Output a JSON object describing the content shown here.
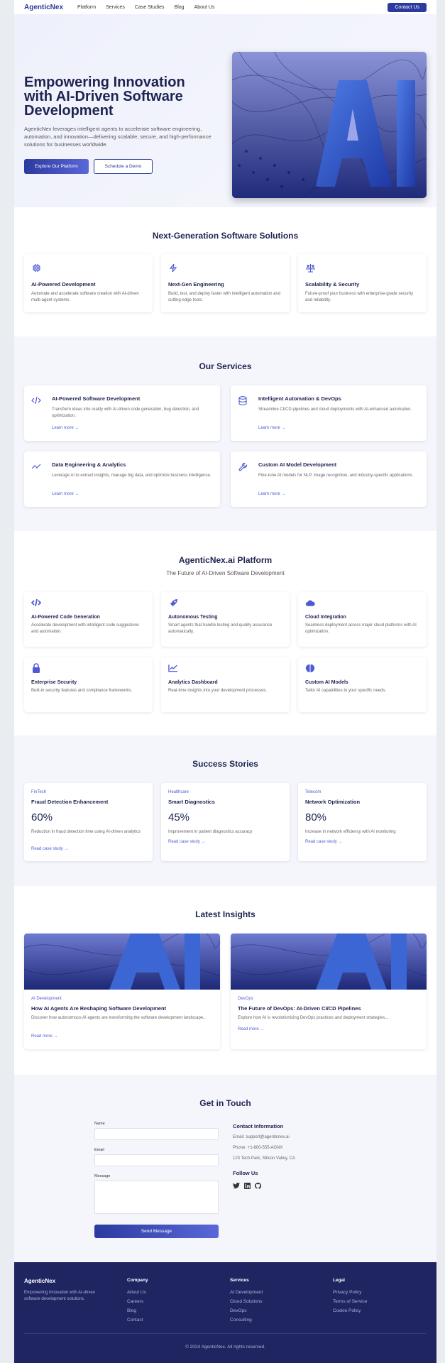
{
  "nav": {
    "logo": "AgenticNex",
    "links": [
      "Platform",
      "Services",
      "Case Studies",
      "Blog",
      "About Us"
    ],
    "cta": "Contact Us"
  },
  "hero": {
    "title": "Empowering Innovation with AI-Driven Software Development",
    "description": "AgenticNex leverages intelligent agents to accelerate software engineering, automation, and innovation—delivering scalable, secure, and high-performance solutions for businesses worldwide.",
    "primary_btn": "Explore Our Platform",
    "secondary_btn": "Schedule a Demo",
    "image_text": "AI"
  },
  "solutions": {
    "heading": "Next-Generation Software Solutions",
    "items": [
      {
        "icon": "chip-icon",
        "title": "AI-Powered Development",
        "desc": "Automate and accelerate software creation with AI-driven multi-agent systems."
      },
      {
        "icon": "bolt-icon",
        "title": "Next-Gen Engineering",
        "desc": "Build, test, and deploy faster with intelligent automation and cutting-edge tools."
      },
      {
        "icon": "scale-icon",
        "title": "Scalability & Security",
        "desc": "Future-proof your business with enterprise-grade security and reliability."
      }
    ]
  },
  "services": {
    "heading": "Our Services",
    "items": [
      {
        "icon": "code-icon",
        "title": "AI-Powered Software Development",
        "desc": "Transform ideas into reality with AI-driven code generation, bug detection, and optimization.",
        "link": "Learn more →"
      },
      {
        "icon": "database-icon",
        "title": "Intelligent Automation & DevOps",
        "desc": "Streamline CI/CD pipelines and cloud deployments with AI-enhanced automation.",
        "link": "Learn more →"
      },
      {
        "icon": "chart-line-icon",
        "title": "Data Engineering & Analytics",
        "desc": "Leverage AI to extract insights, manage big data, and optimize business intelligence.",
        "link": "Learn more →"
      },
      {
        "icon": "wrench-icon",
        "title": "Custom AI Model Development",
        "desc": "Fine-tune AI models for NLP, image recognition, and industry-specific applications.",
        "link": "Learn more →"
      }
    ]
  },
  "platform": {
    "heading": "AgenticNex.ai Platform",
    "subheading": "The Future of AI-Driven Software Development",
    "items": [
      {
        "icon": "code-icon",
        "title": "AI-Powered Code Generation",
        "desc": "Accelerate development with intelligent code suggestions and automation."
      },
      {
        "icon": "rocket-icon",
        "title": "Autonomous Testing",
        "desc": "Smart agents that handle testing and quality assurance automatically."
      },
      {
        "icon": "cloud-icon",
        "title": "Cloud Integration",
        "desc": "Seamless deployment across major cloud platforms with AI optimization."
      },
      {
        "icon": "lock-icon",
        "title": "Enterprise Security",
        "desc": "Built-in security features and compliance frameworks."
      },
      {
        "icon": "analytics-icon",
        "title": "Analytics Dashboard",
        "desc": "Real-time insights into your development processes."
      },
      {
        "icon": "brain-icon",
        "title": "Custom AI Models",
        "desc": "Tailor AI capabilities to your specific needs."
      }
    ]
  },
  "stories": {
    "heading": "Success Stories",
    "items": [
      {
        "tag": "FinTech",
        "title": "Fraud Detection Enhancement",
        "stat": "60%",
        "desc": "Reduction in fraud detection time using AI-driven analytics",
        "link": "Read case study →"
      },
      {
        "tag": "Healthcare",
        "title": "Smart Diagnostics",
        "stat": "45%",
        "desc": "Improvement in patient diagnostics accuracy",
        "link": "Read case study →"
      },
      {
        "tag": "Telecom",
        "title": "Network Optimization",
        "stat": "80%",
        "desc": "Increase in network efficiency with AI monitoring",
        "link": "Read case study →"
      }
    ]
  },
  "insights": {
    "heading": "Latest Insights",
    "items": [
      {
        "tag": "AI Development",
        "title": "How AI Agents Are Reshaping Software Development",
        "desc": "Discover how autonomous AI agents are transforming the software development landscape...",
        "link": "Read more →"
      },
      {
        "tag": "DevOps",
        "title": "The Future of DevOps: AI-Driven CI/CD Pipelines",
        "desc": "Explore how AI is revolutionizing DevOps practices and deployment strategies...",
        "link": "Read more →"
      }
    ]
  },
  "contact": {
    "heading": "Get in Touch",
    "name_label": "Name",
    "email_label": "Email",
    "message_label": "Message",
    "submit": "Send Message",
    "info_heading": "Contact Information",
    "email": "Email: support@agenticnex.ai",
    "phone": "Phone: +1-800-555-AGNX",
    "address": "123 Tech Park, Silicon Valley, CA",
    "follow_heading": "Follow Us",
    "social": [
      "twitter-icon",
      "linkedin-icon",
      "github-icon"
    ]
  },
  "footer": {
    "logo": "AgenticNex",
    "tagline": "Empowering innovation with AI-driven software development solutions.",
    "columns": [
      {
        "heading": "Company",
        "links": [
          "About Us",
          "Careers",
          "Blog",
          "Contact"
        ]
      },
      {
        "heading": "Services",
        "links": [
          "AI Development",
          "Cloud Solutions",
          "DevOps",
          "Consulting"
        ]
      },
      {
        "heading": "Legal",
        "links": [
          "Privacy Policy",
          "Terms of Service",
          "Cookie Policy"
        ]
      }
    ],
    "copyright": "© 2024 AgenticNex. All rights reserved."
  },
  "colors": {
    "primary": "#2c3a9e",
    "accent": "#4f5bd5",
    "footer_bg": "#1e2561",
    "section_bg": "#f5f6fc"
  }
}
